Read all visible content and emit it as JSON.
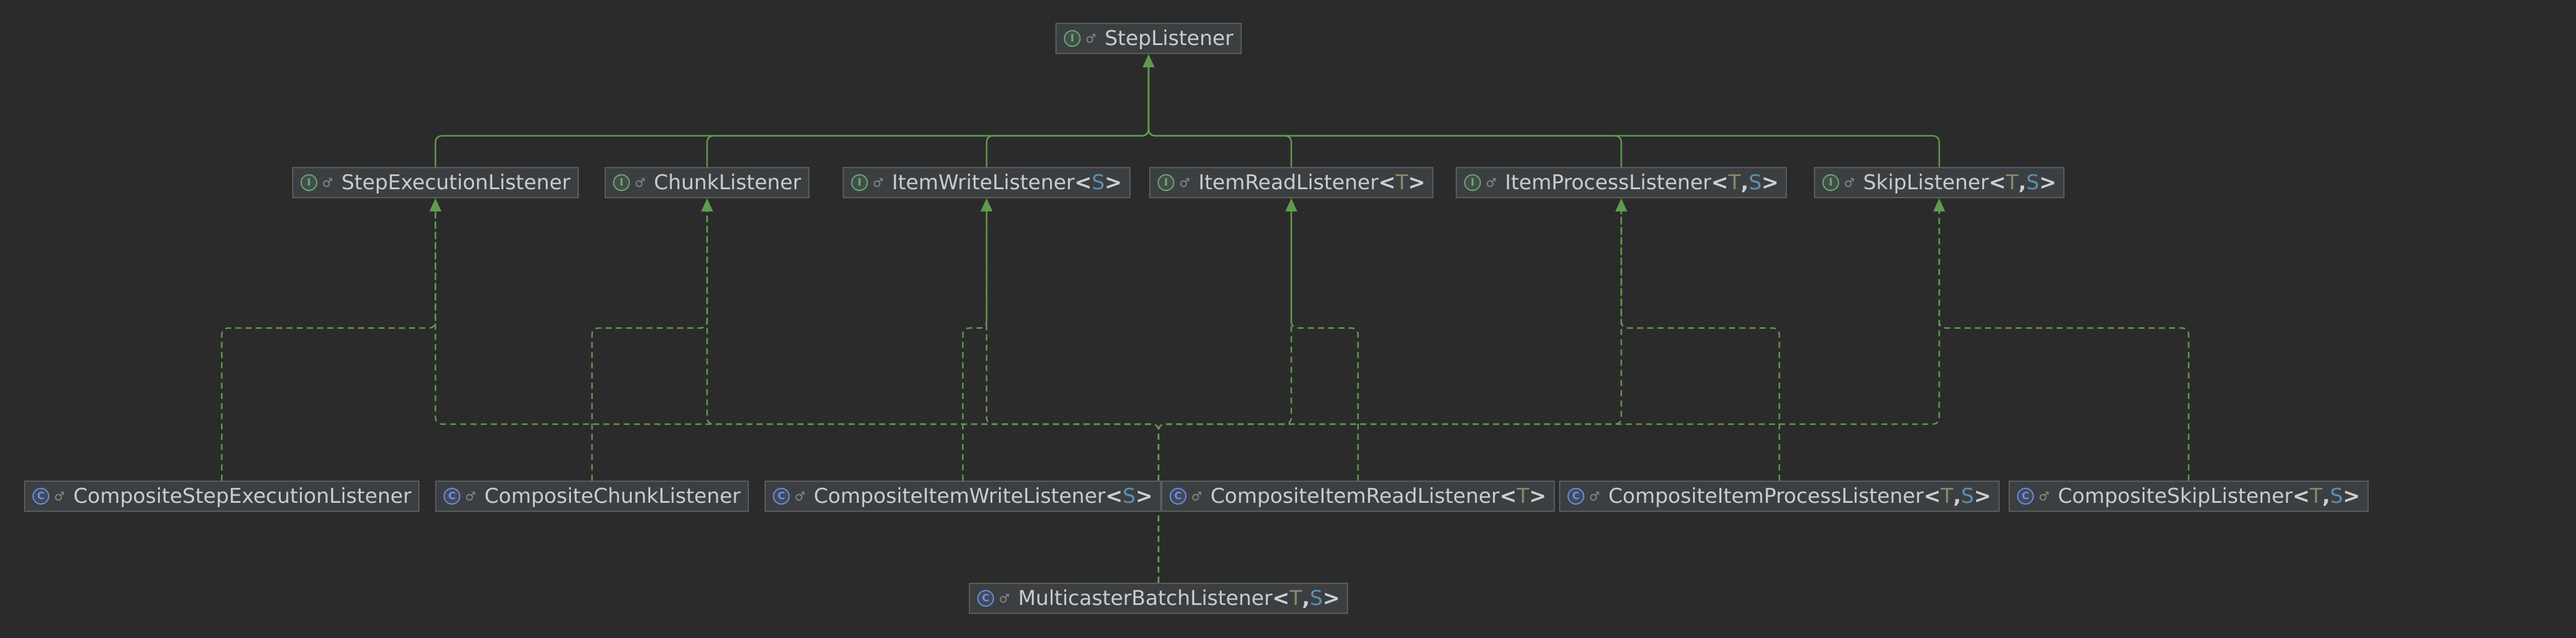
{
  "colors": {
    "background": "#2b2b2b",
    "node_fill": "#3c3f41",
    "node_border": "#5a5d5f",
    "interface_badge": "#6aab73",
    "class_badge": "#6b8fe6",
    "edge": "#5f9b4f",
    "type_param_T": "#8a8a6a",
    "type_param_S": "#5b8fb3",
    "text": "#c9cbcd"
  },
  "nodes": [
    {
      "id": "StepListener",
      "kind": "interface",
      "badge": "I",
      "vis": "♂",
      "name": "StepListener",
      "type_params": []
    },
    {
      "id": "StepExecutionListener",
      "kind": "interface",
      "badge": "I",
      "vis": "♂",
      "name": "StepExecutionListener",
      "type_params": []
    },
    {
      "id": "ChunkListener",
      "kind": "interface",
      "badge": "I",
      "vis": "♂",
      "name": "ChunkListener",
      "type_params": []
    },
    {
      "id": "ItemWriteListener",
      "kind": "interface",
      "badge": "I",
      "vis": "♂",
      "name": "ItemWriteListener",
      "type_params": [
        "S"
      ]
    },
    {
      "id": "ItemReadListener",
      "kind": "interface",
      "badge": "I",
      "vis": "♂",
      "name": "ItemReadListener",
      "type_params": [
        "T"
      ]
    },
    {
      "id": "ItemProcessListener",
      "kind": "interface",
      "badge": "I",
      "vis": "♂",
      "name": "ItemProcessListener",
      "type_params": [
        "T",
        "S"
      ]
    },
    {
      "id": "SkipListener",
      "kind": "interface",
      "badge": "I",
      "vis": "♂",
      "name": "SkipListener",
      "type_params": [
        "T",
        "S"
      ]
    },
    {
      "id": "CompositeStepExecutionListener",
      "kind": "class",
      "badge": "C",
      "vis": "♂",
      "name": "CompositeStepExecutionListener",
      "type_params": []
    },
    {
      "id": "CompositeChunkListener",
      "kind": "class",
      "badge": "C",
      "vis": "♂",
      "name": "CompositeChunkListener",
      "type_params": []
    },
    {
      "id": "CompositeItemWriteListener",
      "kind": "class",
      "badge": "C",
      "vis": "♂",
      "name": "CompositeItemWriteListener",
      "type_params": [
        "S"
      ]
    },
    {
      "id": "CompositeItemReadListener",
      "kind": "class",
      "badge": "C",
      "vis": "♂",
      "name": "CompositeItemReadListener",
      "type_params": [
        "T"
      ]
    },
    {
      "id": "CompositeItemProcessListener",
      "kind": "class",
      "badge": "C",
      "vis": "♂",
      "name": "CompositeItemProcessListener",
      "type_params": [
        "T",
        "S"
      ]
    },
    {
      "id": "CompositeSkipListener",
      "kind": "class",
      "badge": "C",
      "vis": "♂",
      "name": "CompositeSkipListener",
      "type_params": [
        "T",
        "S"
      ]
    },
    {
      "id": "MulticasterBatchListener",
      "kind": "class",
      "badge": "C",
      "vis": "♂",
      "name": "MulticasterBatchListener",
      "type_params": [
        "T",
        "S"
      ]
    }
  ],
  "edges": [
    {
      "from": "StepExecutionListener",
      "to": "StepListener",
      "type": "extends"
    },
    {
      "from": "ChunkListener",
      "to": "StepListener",
      "type": "extends"
    },
    {
      "from": "ItemWriteListener",
      "to": "StepListener",
      "type": "extends"
    },
    {
      "from": "ItemReadListener",
      "to": "StepListener",
      "type": "extends"
    },
    {
      "from": "ItemProcessListener",
      "to": "StepListener",
      "type": "extends"
    },
    {
      "from": "SkipListener",
      "to": "StepListener",
      "type": "extends"
    },
    {
      "from": "CompositeStepExecutionListener",
      "to": "StepExecutionListener",
      "type": "implements"
    },
    {
      "from": "CompositeChunkListener",
      "to": "ChunkListener",
      "type": "implements"
    },
    {
      "from": "CompositeItemWriteListener",
      "to": "ItemWriteListener",
      "type": "implements"
    },
    {
      "from": "CompositeItemReadListener",
      "to": "ItemReadListener",
      "type": "implements"
    },
    {
      "from": "CompositeItemProcessListener",
      "to": "ItemProcessListener",
      "type": "implements"
    },
    {
      "from": "CompositeSkipListener",
      "to": "SkipListener",
      "type": "implements"
    },
    {
      "from": "MulticasterBatchListener",
      "to": "StepExecutionListener",
      "type": "implements"
    },
    {
      "from": "MulticasterBatchListener",
      "to": "ChunkListener",
      "type": "implements"
    },
    {
      "from": "MulticasterBatchListener",
      "to": "ItemWriteListener",
      "type": "implements"
    },
    {
      "from": "MulticasterBatchListener",
      "to": "ItemReadListener",
      "type": "implements"
    },
    {
      "from": "MulticasterBatchListener",
      "to": "ItemProcessListener",
      "type": "implements"
    },
    {
      "from": "MulticasterBatchListener",
      "to": "SkipListener",
      "type": "implements"
    }
  ]
}
